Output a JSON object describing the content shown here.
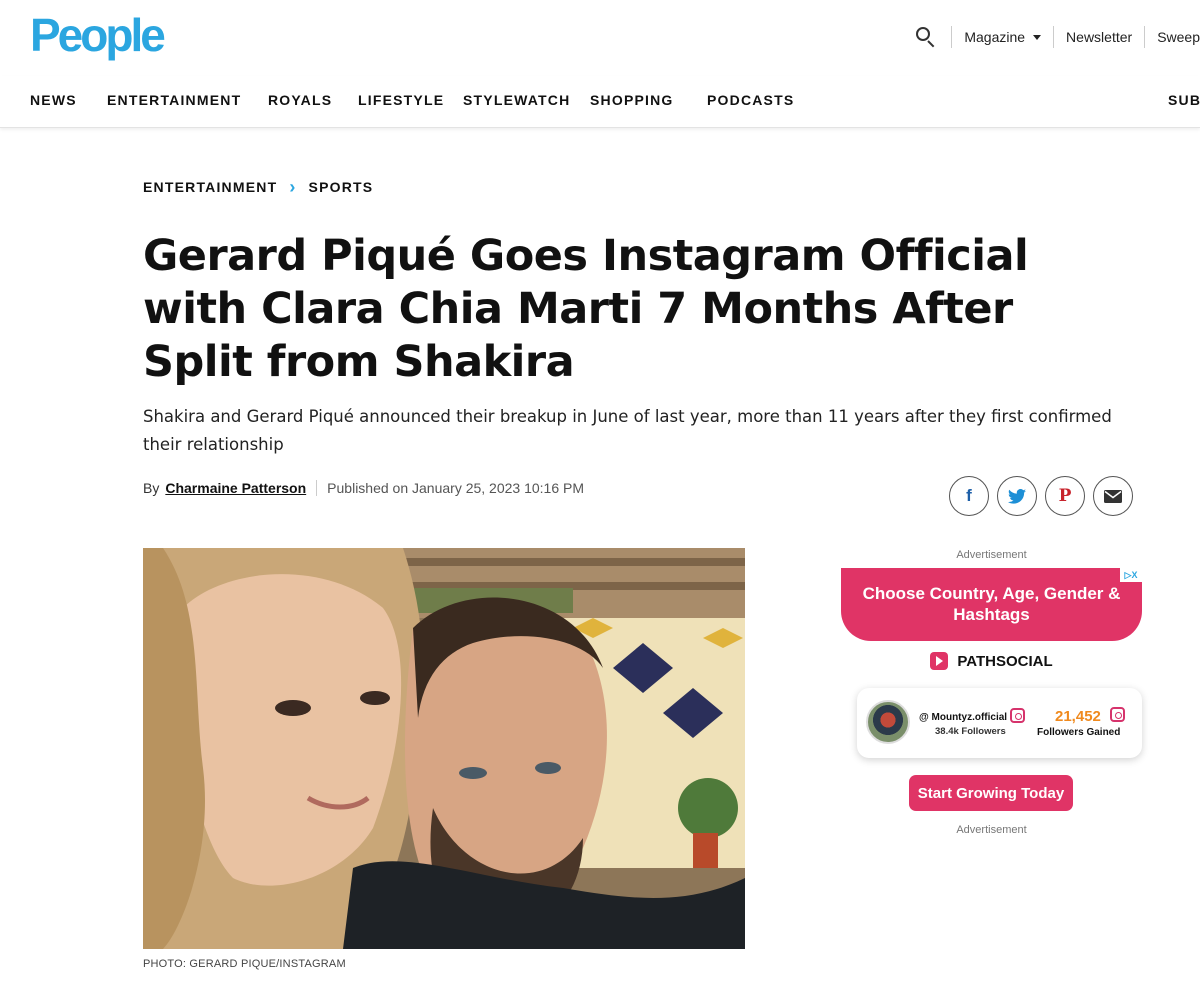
{
  "header": {
    "logo": "People",
    "search_icon": "search-icon",
    "top_links": {
      "magazine": "Magazine",
      "newsletter": "Newsletter",
      "sweep": "Sweep"
    }
  },
  "nav": {
    "items": [
      "NEWS",
      "ENTERTAINMENT",
      "ROYALS",
      "LIFESTYLE",
      "STYLEWATCH",
      "SHOPPING",
      "PODCASTS"
    ],
    "subscribe": "SUB"
  },
  "article": {
    "breadcrumb": [
      "ENTERTAINMENT",
      "SPORTS"
    ],
    "headline": "Gerard Piqué Goes Instagram Official with Clara Chia Marti 7 Months After Split from Shakira",
    "dek": "Shakira and Gerard Piqué announced their breakup in June of last year, more than 11 years after they first confirmed their relationship",
    "byline_prefix": "By",
    "author": "Charmaine Patterson",
    "published": "Published on January 25, 2023 10:16 PM",
    "caption": "PHOTO: GERARD PIQUE/INSTAGRAM"
  },
  "share": {
    "facebook": "f",
    "twitter_icon": "twitter-icon",
    "pinterest": "P",
    "email_icon": "email-icon"
  },
  "ad": {
    "label_top": "Advertisement",
    "headline": "Choose Country, Age, Gender & Hashtags",
    "brand": "PATHSOCIAL",
    "handle": "@ Mountyz.official",
    "followers": "38.4k Followers",
    "gained": "21,452",
    "gained_label": "Followers Gained",
    "cta": "Start Growing Today",
    "label_bottom": "Advertisement",
    "choices_mark": "▷X"
  },
  "colors": {
    "brand_blue": "#2ba6e0",
    "ad_pink": "#e03466",
    "ad_orange": "#f08a1e"
  }
}
